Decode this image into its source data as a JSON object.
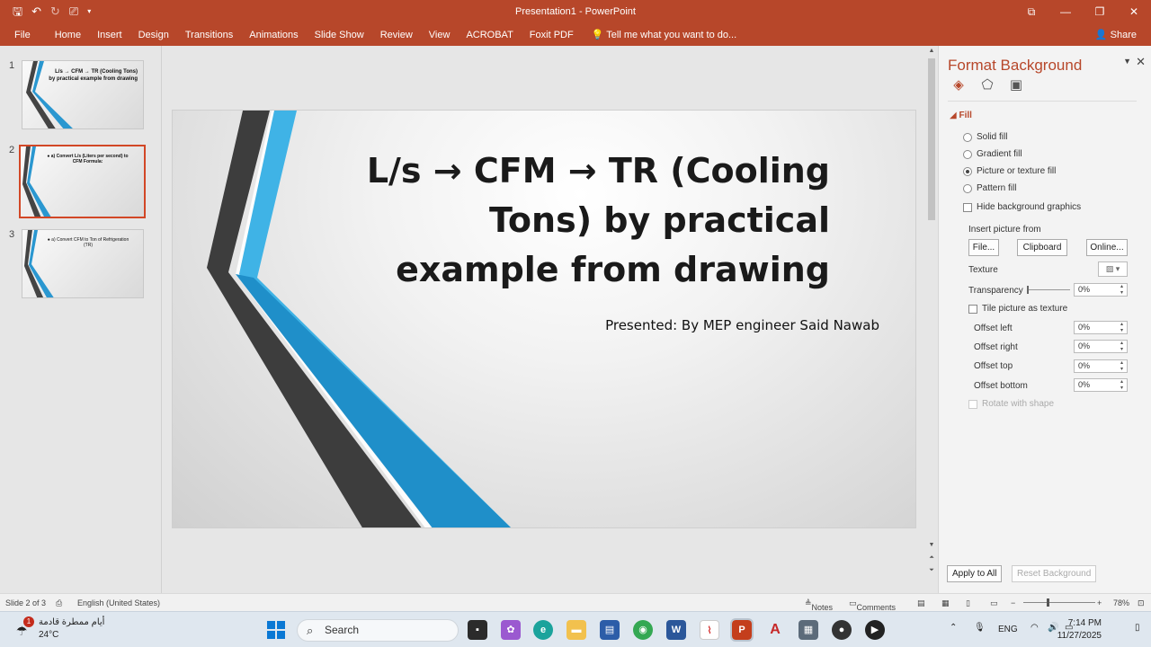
{
  "window": {
    "title": "Presentation1 - PowerPoint",
    "share_label": "Share"
  },
  "ribbon": {
    "tabs": [
      "File",
      "Home",
      "Insert",
      "Design",
      "Transitions",
      "Animations",
      "Slide Show",
      "Review",
      "View",
      "ACROBAT",
      "Foxit PDF"
    ],
    "tell_me": "Tell me what you want to do..."
  },
  "thumbnails": [
    {
      "number": "1",
      "title": "L/s → CFM → TR (Cooling Tons) by practical example from drawing"
    },
    {
      "number": "2",
      "title": "● a) Convert L/s (Liters per second) to CFM Formula:"
    },
    {
      "number": "3",
      "title": "● a) Convert CFM to Ton of Refrigeration (TR)"
    }
  ],
  "slide": {
    "title": "L/s → CFM → TR (Cooling Tons) by practical example from drawing",
    "subtitle": "Presented: By MEP engineer Said Nawab"
  },
  "format_pane": {
    "title": "Format Background",
    "fill_header": "Fill",
    "fill_options": [
      {
        "label": "Solid fill",
        "selected": false
      },
      {
        "label": "Gradient fill",
        "selected": false
      },
      {
        "label": "Picture or texture fill",
        "selected": true
      },
      {
        "label": "Pattern fill",
        "selected": false
      }
    ],
    "hide_bg_graphics": "Hide background graphics",
    "insert_from": "Insert picture from",
    "btn_file": "File...",
    "btn_clipboard": "Clipboard",
    "btn_online": "Online...",
    "texture_label": "Texture",
    "transparency_label": "Transparency",
    "transparency_value": "0%",
    "tile_label": "Tile picture as texture",
    "offsets": [
      {
        "label": "Offset left",
        "value": "0%"
      },
      {
        "label": "Offset right",
        "value": "0%"
      },
      {
        "label": "Offset top",
        "value": "0%"
      },
      {
        "label": "Offset bottom",
        "value": "0%"
      }
    ],
    "rotate_label": "Rotate with shape",
    "apply_all": "Apply to All",
    "reset_bg": "Reset Background"
  },
  "status": {
    "slide_count": "Slide 2 of 3",
    "language": "English (United States)",
    "notes": "Notes",
    "comments": "Comments",
    "zoom": "78%"
  },
  "taskbar": {
    "weather_text": "أيام ممطرة قادمة",
    "temperature": "24°C",
    "notification_count": "1",
    "search_placeholder": "Search",
    "lang": "ENG",
    "time": "7:14 PM",
    "date": "11/27/2025"
  },
  "colors": {
    "accent": "#b7472a",
    "slide_blue": "#1f8fc9",
    "slide_lightblue": "#3fb3e6",
    "slide_dark": "#3a3a3a"
  }
}
